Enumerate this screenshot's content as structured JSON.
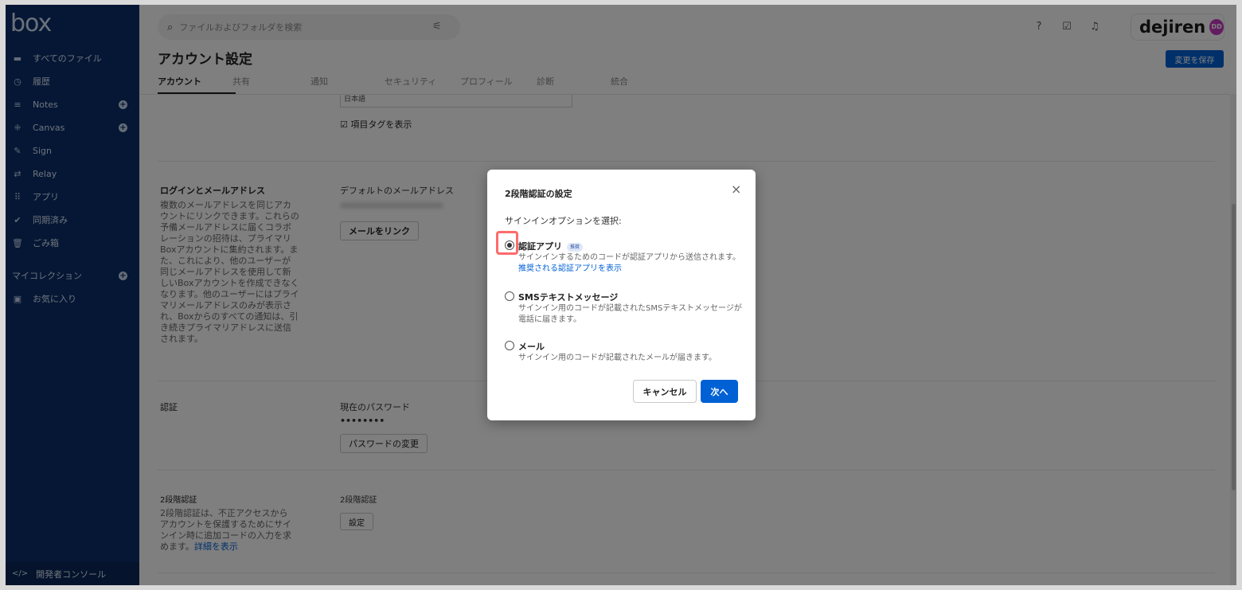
{
  "app": {
    "logo": "box",
    "brand": "dejiren",
    "avatar_initials": "DD"
  },
  "sidebar": {
    "items": [
      {
        "label": "すべてのファイル",
        "icon": "folder-icon",
        "glyph": "▬"
      },
      {
        "label": "履歴",
        "icon": "clock-icon",
        "glyph": "◷"
      },
      {
        "label": "Notes",
        "icon": "notes-icon",
        "glyph": "≡",
        "has_add": true
      },
      {
        "label": "Canvas",
        "icon": "canvas-icon",
        "glyph": "⁜",
        "has_add": true
      },
      {
        "label": "Sign",
        "icon": "sign-icon",
        "glyph": "✎"
      },
      {
        "label": "Relay",
        "icon": "relay-icon",
        "glyph": "⇄"
      },
      {
        "label": "アプリ",
        "icon": "apps-grid-icon",
        "glyph": "⠿"
      },
      {
        "label": "同期済み",
        "icon": "check-circle-icon",
        "glyph": "✔"
      },
      {
        "label": "ごみ箱",
        "icon": "trash-icon",
        "glyph": "🗑"
      },
      {
        "label": "マイコレクション",
        "icon": "",
        "glyph": "",
        "has_add": true
      },
      {
        "label": "お気に入り",
        "icon": "star-box-icon",
        "glyph": "▣"
      }
    ],
    "dev_console": "開発者コンソール",
    "dev_console_glyph": "</>"
  },
  "search": {
    "placeholder": "ファイルおよびフォルダを検索"
  },
  "page": {
    "title": "アカウント設定",
    "save_label": "変更を保存",
    "tabs": [
      "アカウント",
      "共有",
      "通知",
      "セキュリティ",
      "プロフィール",
      "診断",
      "統合"
    ]
  },
  "content": {
    "language_value": "日本語",
    "show_tags_label": "項目タグを表示",
    "login_section": {
      "title": "ログインとメールアドレス",
      "description": "複数のメールアドレスを同じアカウントにリンクできます。これらの予備メールアドレスに届くコラボレーションの招待は、プライマリBoxアカウントに集約されます。また、これにより、他のユーザーが同じメールアドレスを使用して新しいBoxアカウントを作成できなくなります。他のユーザーにはプライマリメールアドレスのみが表示され、Boxからのすべての通知は、引き続きプライマリアドレスに送信されます。",
      "field_label": "デフォルトのメールアドレス",
      "button": "メールをリンク"
    },
    "auth_section": {
      "title": "認証",
      "field_label": "現在のパスワード",
      "password_mask": "••••••••",
      "button": "パスワードの変更"
    },
    "twofa_section": {
      "title": "2段階認証",
      "description": "2段階認証は、不正アクセスからアカウントを保護するためにサインイン時に追加コードの入力を求めます。",
      "link": "詳細を表示",
      "field_label": "2段階認証",
      "button": "設定"
    }
  },
  "modal": {
    "title": "2段階認証の設定",
    "subtitle": "サインインオプションを選択:",
    "options": [
      {
        "title": "認証アプリ",
        "badge": "推奨",
        "description": "サインインするためのコードが認証アプリから送信されます。",
        "link": "推奨される認証アプリを表示",
        "checked": true
      },
      {
        "title": "SMSテキストメッセージ",
        "description": "サインイン用のコードが記載されたSMSテキストメッセージが電話に届きます。",
        "checked": false
      },
      {
        "title": "メール",
        "description": "サインイン用のコードが記載されたメールが届きます。",
        "checked": false
      }
    ],
    "cancel": "キャンセル",
    "next": "次へ",
    "close_glyph": "×"
  },
  "colors": {
    "sidebar_bg": "#0b2f6b",
    "primary": "#0061d5",
    "highlight": "#ff6b6b",
    "avatar": "#c438c0"
  }
}
